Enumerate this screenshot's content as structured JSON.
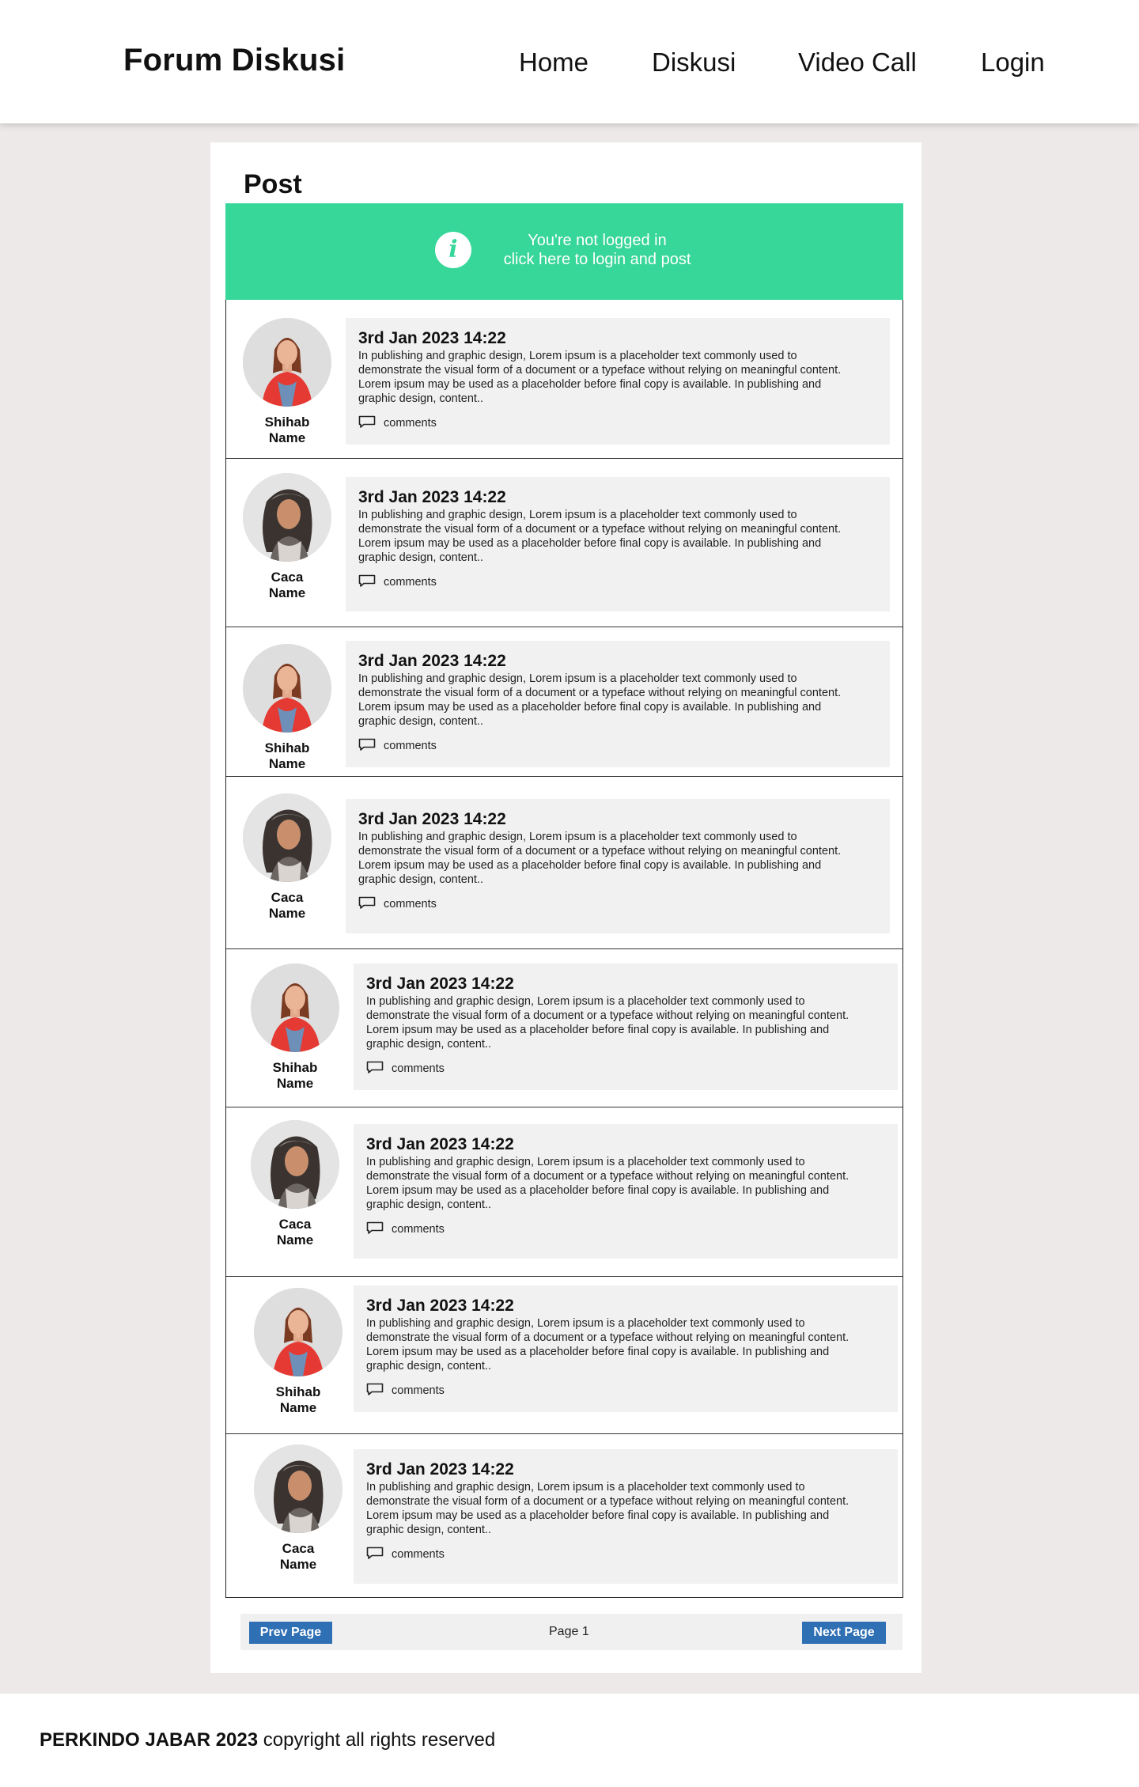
{
  "header": {
    "brand": "Forum Diskusi",
    "nav": [
      "Home",
      "Diskusi",
      "Video Call",
      "Login"
    ]
  },
  "main": {
    "title": "Post",
    "notice": {
      "line1": "You're not logged in",
      "line2": "click here to login and post",
      "icon": "info-icon",
      "color": "#37d699"
    },
    "posts": [
      {
        "first": "Shihab",
        "last": "Name",
        "date": "3rd Jan 2023  14:22",
        "comments": "comments"
      },
      {
        "first": "Caca",
        "last": "Name",
        "date": "3rd Jan 2023  14:22",
        "comments": "comments"
      },
      {
        "first": "Shihab",
        "last": "Name",
        "date": "3rd Jan 2023  14:22",
        "comments": "comments"
      },
      {
        "first": "Caca",
        "last": "Name",
        "date": "3rd Jan 2023  14:22",
        "comments": "comments"
      },
      {
        "first": "Shihab",
        "last": "Name",
        "date": "3rd Jan 2023  14:22",
        "comments": "comments"
      },
      {
        "first": "Caca",
        "last": "Name",
        "date": "3rd Jan 2023  14:22",
        "comments": "comments"
      },
      {
        "first": "Shihab",
        "last": "Name",
        "date": "3rd Jan 2023  14:22",
        "comments": "comments"
      },
      {
        "first": "Caca",
        "last": "Name",
        "date": "3rd Jan 2023  14:22",
        "comments": "comments"
      }
    ],
    "post_body": "In publishing and graphic design, Lorem ipsum is a placeholder text commonly used to demonstrate the visual form of a document or a typeface without relying on meaningful content. Lorem ipsum may be used as a placeholder before final copy is available. In publishing and graphic design,  content..",
    "pager": {
      "prev": "Prev Page",
      "label": "Page 1",
      "next": "Next Page",
      "button_color": "#2f6fb3"
    }
  },
  "footer": {
    "org": "PERKINDO JABAR 2023",
    "text": " copyright all rights reserved"
  }
}
